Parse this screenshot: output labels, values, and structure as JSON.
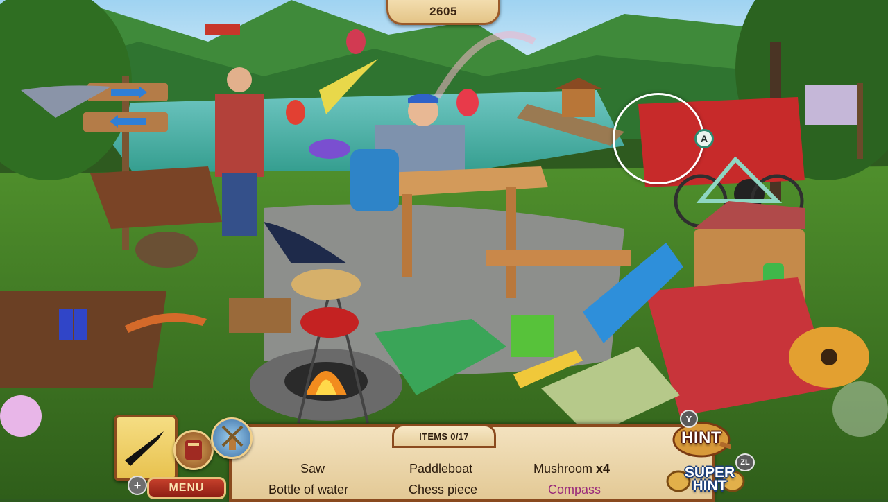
{
  "score": "2605",
  "cursor": {
    "button": "A"
  },
  "hud": {
    "items_counter": "ITEMS 0/17",
    "menu_label": "MENU",
    "menu_button_badge": "+",
    "hint_label": "HINT",
    "hint_button_badge": "Y",
    "super_hint_label_line1": "SUPER",
    "super_hint_label_line2": "HINT",
    "super_hint_button_badge": "ZL",
    "preview_item_icon": "hang-glider-icon"
  },
  "items": [
    {
      "name": "Saw",
      "count": "",
      "state": "pending"
    },
    {
      "name": "Paddleboat",
      "count": "",
      "state": "pending"
    },
    {
      "name": "Mushroom",
      "count": "x4",
      "state": "pending"
    },
    {
      "name": "Bottle of water",
      "count": "",
      "state": "pending"
    },
    {
      "name": "Chess piece",
      "count": "",
      "state": "pending"
    },
    {
      "name": "Compass",
      "count": "",
      "state": "highlighted"
    }
  ],
  "colors": {
    "panel": "#ecd5a6",
    "panel_border": "#8a4a1e",
    "menu_red": "#b0301f",
    "highlight_item": "#9a2a7a"
  }
}
